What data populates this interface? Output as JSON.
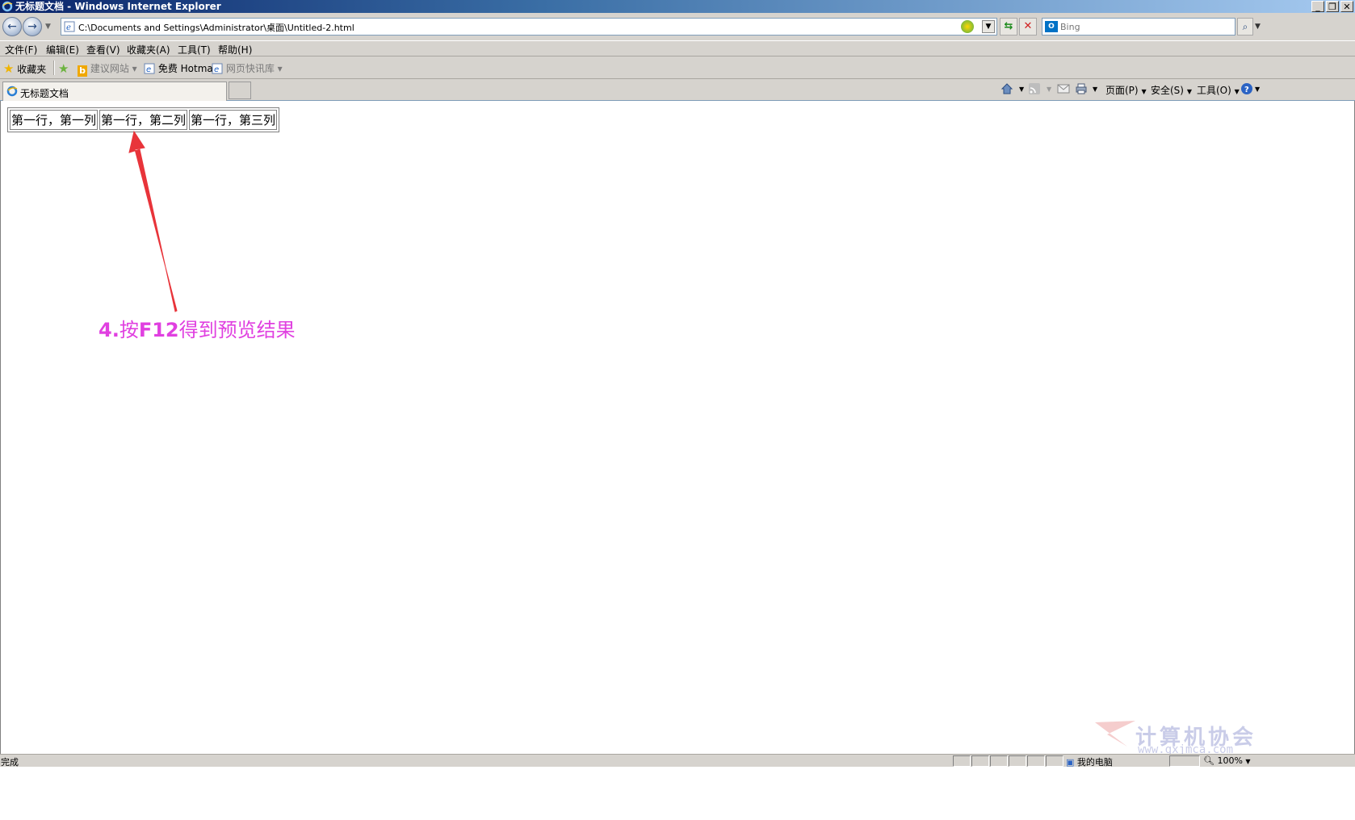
{
  "window": {
    "title": "无标题文档 - Windows Internet Explorer"
  },
  "address": {
    "url": "C:\\Documents and Settings\\Administrator\\桌面\\Untitled-2.html"
  },
  "search": {
    "placeholder": "Bing",
    "badge": "O"
  },
  "menu": [
    "文件(F)",
    "编辑(E)",
    "查看(V)",
    "收藏夹(A)",
    "工具(T)",
    "帮助(H)"
  ],
  "favorites": {
    "favorites_label": "收藏夹",
    "suggested_sites": "建议网站",
    "hotmail": "免费 Hotmail",
    "web_slice": "网页快讯库"
  },
  "tab": {
    "title": "无标题文档"
  },
  "commands": {
    "page": "页面(P)",
    "safety": "安全(S)",
    "tools": "工具(O)"
  },
  "table": {
    "rows": [
      [
        "第一行，第一列",
        "第一行，第二列",
        "第一行，第三列"
      ]
    ]
  },
  "annotation": {
    "num": "4.",
    "text1": "按",
    "key": "F12",
    "text2": "得到预览结果"
  },
  "watermark": {
    "text": "计算机协会",
    "url": "www.gxjmca.com"
  },
  "status": {
    "text": "完成",
    "zone": "我的电脑",
    "zoom": "100%"
  },
  "colors": {
    "annotation": "#e040e0",
    "arrow": "#e8343a",
    "titlebar": "#0a246a"
  }
}
